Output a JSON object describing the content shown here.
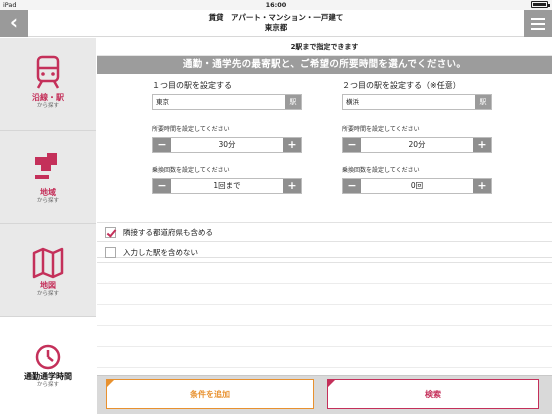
{
  "status_bar": {
    "device": "iPad",
    "time": "16:00"
  },
  "header": {
    "title_line1": "賃貸　アパート・マンション・一戸建て",
    "title_line2": "東京都"
  },
  "sidebar": {
    "items": [
      {
        "label": "沿線・駅",
        "sub": "から探す"
      },
      {
        "label": "地域",
        "sub": "から探す"
      },
      {
        "label": "地図",
        "sub": "から探す"
      },
      {
        "label": "通勤通学時間",
        "sub": "から探す"
      }
    ]
  },
  "main": {
    "top_note": "2駅まで指定できます",
    "banner": "通勤・通学先の最寄駅と、ご希望の所要時間を選んでください。",
    "station1": {
      "title": "１つ目の駅を設定する",
      "value": "東京",
      "station_btn": "駅",
      "time_label": "所要時間を設定してください",
      "time_value": "30分",
      "transfer_label": "乗換回数を設定してください",
      "transfer_value": "1回まで"
    },
    "station2": {
      "title": "２つ目の駅を設定する（※任意）",
      "value": "横浜",
      "station_btn": "駅",
      "time_label": "所要時間を設定してください",
      "time_value": "20分",
      "transfer_label": "乗換回数を設定してください",
      "transfer_value": "0回"
    },
    "stepper_minus": "−",
    "stepper_plus": "+",
    "options": [
      {
        "label": "隣接する都道府県も含める",
        "checked": true
      },
      {
        "label": "入力した駅を含めない",
        "checked": false
      }
    ]
  },
  "footer": {
    "add_label": "条件を追加",
    "search_label": "検索"
  },
  "colors": {
    "accent": "#c4305a",
    "orange": "#e8912f",
    "banner": "#9c9c9c"
  }
}
